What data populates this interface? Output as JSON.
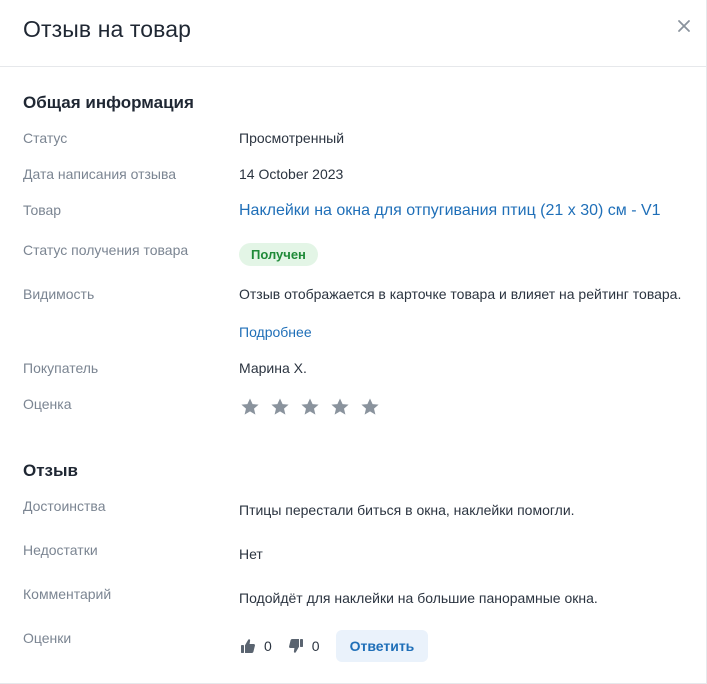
{
  "header": {
    "title": "Отзыв на товар"
  },
  "general": {
    "section_title": "Общая информация",
    "status_label": "Статус",
    "status_value": "Просмотренный",
    "date_label": "Дата написания отзыва",
    "date_value": "14 October 2023",
    "product_label": "Товар",
    "product_value": "Наклейки на окна для отпугивания птиц (21 х 30) см - V1",
    "receipt_label": "Статус получения товара",
    "receipt_badge": "Получен",
    "visibility_label": "Видимость",
    "visibility_text": "Отзыв отображается в карточке товара и влияет на рейтинг товара.",
    "visibility_link": "Подробнее",
    "buyer_label": "Покупатель",
    "buyer_value": "Марина Х.",
    "rating_label": "Оценка",
    "rating_stars": 0,
    "rating_max": 5
  },
  "review": {
    "section_title": "Отзыв",
    "pros_label": "Достоинства",
    "pros_value": "Птицы перестали биться в окна, наклейки помогли.",
    "cons_label": "Недостатки",
    "cons_value": "Нет",
    "comment_label": "Комментарий",
    "comment_value": "Подойдёт для наклейки на большие панорамные окна.",
    "votes_label": "Оценки",
    "likes": "0",
    "dislikes": "0",
    "reply_button": "Ответить"
  },
  "colors": {
    "link": "#1f6fb8",
    "badge_bg": "#e3f5e6",
    "badge_text": "#1f8a38",
    "star_empty": "#8a939d"
  },
  "icons": [
    "close-icon",
    "star-icon",
    "thumbs-up-icon",
    "thumbs-down-icon"
  ]
}
